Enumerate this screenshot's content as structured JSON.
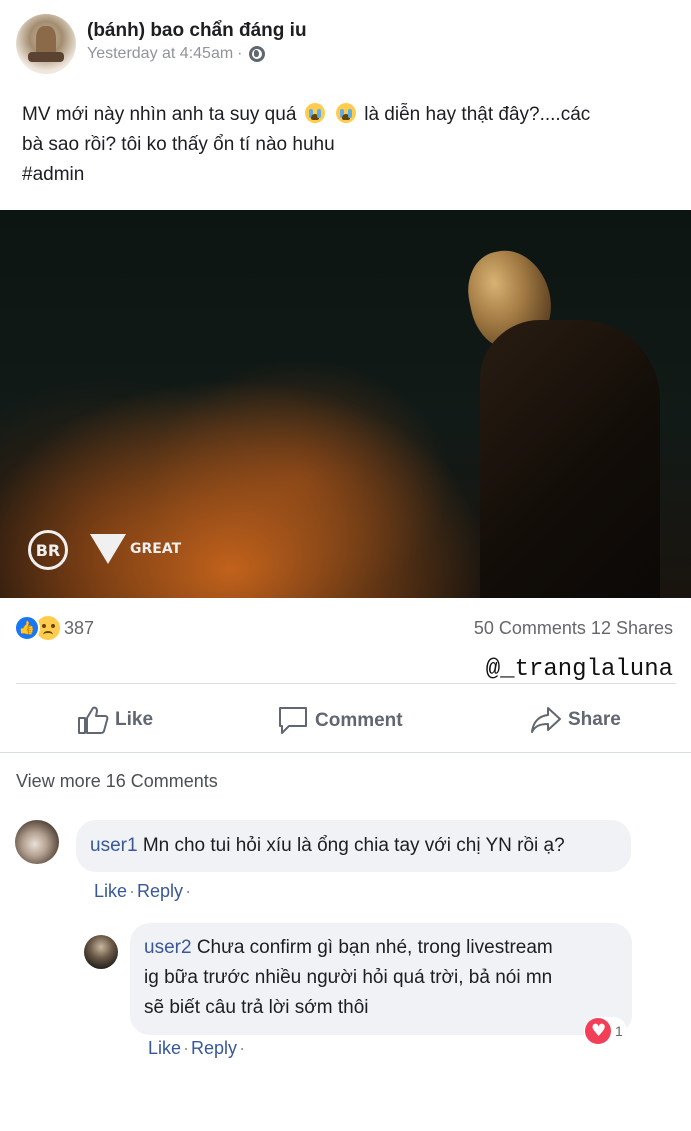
{
  "post": {
    "page_name": "(bánh) bao chẩn đáng iu",
    "timestamp": "Yesterday at 4:45am",
    "meta_separator": "·",
    "privacy_icon": "globe-icon",
    "text_line1_a": "MV mới này nhìn anh ta suy quá",
    "text_line1_b": "là diễn hay thật đây?....các",
    "text_line2": "bà sao rồi? tôi ko thấy ổn tí nào huhu",
    "hashtag": "#admin",
    "emoji_icon": "loudly-crying-face-icon",
    "image_logos": {
      "logo_left": "BR",
      "logo_right": "GREAT"
    }
  },
  "engagement": {
    "reaction_icons": [
      "like-icon",
      "sad-icon"
    ],
    "reaction_count": "387",
    "comments_shares": "50 Comments 12 Shares",
    "watermark": "@_tranglaluna"
  },
  "actions": {
    "like_label": "Like",
    "comment_label": "Comment",
    "share_label": "Share"
  },
  "comments": {
    "view_more": "View more 16 Comments",
    "items": [
      {
        "author": "user1",
        "text": "Mn cho tui hỏi xíu là ổng chia tay với chị YN rồi ạ?",
        "like": "Like",
        "reply": "Reply",
        "sep": "·"
      },
      {
        "author": "user2",
        "text_line1": "Chưa confirm gì bạn nhé, trong livestream",
        "text_line2": "ig bữa trước nhiều người hỏi quá trời, bả nói mn",
        "text_line3": "sẽ biết câu trả lời sớm thôi",
        "like": "Like",
        "reply": "Reply",
        "sep": "·",
        "reaction_icon": "heart-icon",
        "reaction_count": "1"
      }
    ]
  },
  "colors": {
    "link": "#385898",
    "like_blue": "#1877f2",
    "heart_red": "#f33e58",
    "bubble_bg": "#f0f2f5",
    "muted": "#65676b"
  }
}
